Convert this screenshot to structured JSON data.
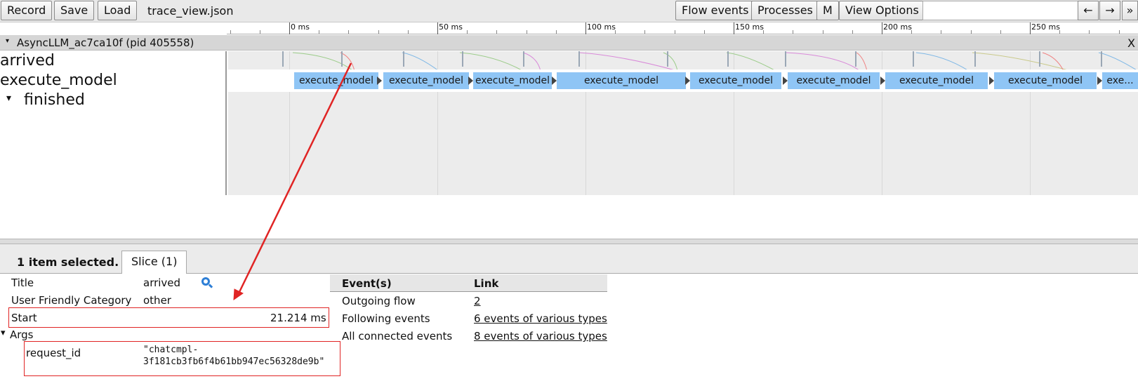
{
  "toolbar": {
    "record_label": "Record",
    "save_label": "Save",
    "load_label": "Load",
    "filename": "trace_view.json",
    "flow_events_label": "Flow events",
    "processes_label": "Processes",
    "m_label": "M",
    "view_options_label": "View Options",
    "search_value": "",
    "prev_label": "←",
    "next_label": "→",
    "more_label": "»"
  },
  "ruler": {
    "labels": [
      "0 ms",
      "50 ms",
      "100 ms",
      "150 ms",
      "200 ms",
      "250 ms"
    ]
  },
  "process": {
    "title": "AsyncLLM_ac7ca10f (pid 405558)",
    "expand_glyph": "▾",
    "close_label": "X"
  },
  "tracks": {
    "arrived_label": "arrived",
    "execute_model_label": "execute_model",
    "finished_label": "finished",
    "finished_glyph": "▾",
    "slices": [
      "execute_model",
      "execute_model",
      "execute_model",
      "execute_model",
      "execute_model",
      "execute_model",
      "execute_model",
      "execute_model",
      "exe..."
    ]
  },
  "bottom": {
    "selection_count": "1 item selected.",
    "slice_tab": "Slice (1)"
  },
  "details": {
    "title_label": "Title",
    "title_value": "arrived",
    "category_label": "User Friendly Category",
    "category_value": "other",
    "start_label": "Start",
    "start_value": "21.214 ms",
    "args_label": "Args",
    "args_glyph": "▾",
    "request_id_label": "request_id",
    "request_id_line1": "\"chatcmpl-",
    "request_id_line2": "3f181cb3fb6f4b61bb947ec56328de9b\""
  },
  "events": {
    "col1": "Event(s)",
    "col2": "Link",
    "rows": [
      {
        "name": "Outgoing flow",
        "link": "2"
      },
      {
        "name": "Following events",
        "link": "6 events of various types"
      },
      {
        "name": "All connected events",
        "link": "8 events of various types"
      }
    ]
  },
  "colors": {
    "slice": "#8fc5f5",
    "highlight": "#e02424",
    "accent": "#2e7fd6"
  }
}
